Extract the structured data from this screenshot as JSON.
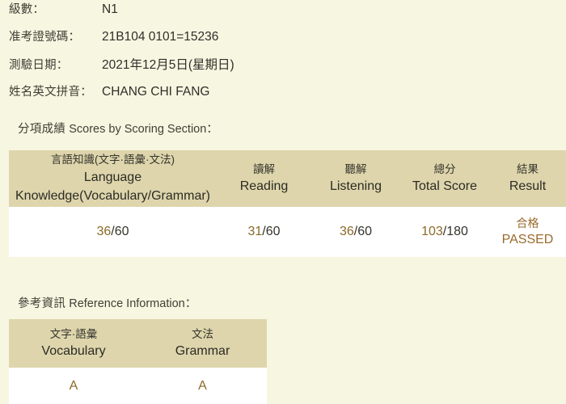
{
  "candidate_info": {
    "rows": [
      {
        "label": "級數：",
        "value": "N1"
      },
      {
        "label": "准考證號碼：",
        "value": "21B104 0101=15236"
      },
      {
        "label": "測驗日期：",
        "value": "2021年12月5日(星期日)"
      },
      {
        "label": "姓名英文拼音：",
        "value": "CHANG CHI FANG"
      }
    ]
  },
  "scores_section": {
    "heading_cjk": "分項成績",
    "heading_en": "Scores by Scoring Section：",
    "columns": [
      {
        "cjk": "言語知識(文字·語彙·文法)",
        "en_line1": "Language",
        "en_line2": "Knowledge(Vocabulary/Grammar)"
      },
      {
        "cjk": "讀解",
        "en_line1": "Reading",
        "en_line2": ""
      },
      {
        "cjk": "聽解",
        "en_line1": "Listening",
        "en_line2": ""
      },
      {
        "cjk": "總分",
        "en_line1": "Total Score",
        "en_line2": ""
      },
      {
        "cjk": "結果",
        "en_line1": "Result",
        "en_line2": ""
      }
    ],
    "values": {
      "language_knowledge": {
        "score": "36",
        "max": "/60"
      },
      "reading": {
        "score": "31",
        "max": "/60"
      },
      "listening": {
        "score": "36",
        "max": "/60"
      },
      "total": {
        "score": "103",
        "max": "/180"
      },
      "result": {
        "cjk": "合格",
        "en": "PASSED"
      }
    }
  },
  "reference_section": {
    "heading_cjk": "參考資訊",
    "heading_en": "Reference Information：",
    "columns": [
      {
        "cjk": "文字·語彙",
        "en": "Vocabulary"
      },
      {
        "cjk": "文法",
        "en": "Grammar"
      }
    ],
    "values": {
      "vocabulary": "A",
      "grammar": "A"
    }
  },
  "colors": {
    "page_background": "#f7f6e1",
    "table_header": "#ded5ac",
    "table_body": "#ffffff",
    "score_accent": "#8a6a28",
    "result_accent": "#9a6a2c",
    "text": "#33332b"
  }
}
